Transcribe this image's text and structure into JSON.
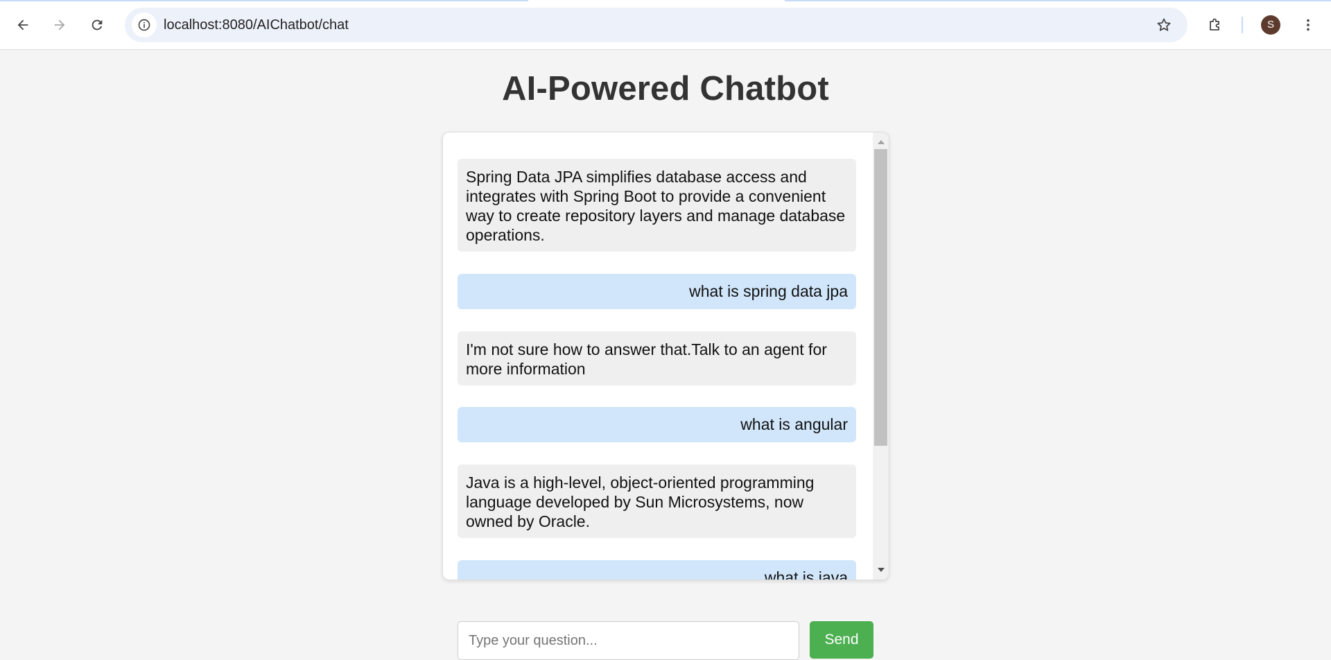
{
  "browser": {
    "url": "localhost:8080/AIChatbot/chat",
    "avatar_initial": "S",
    "icons": {
      "back": "arrow-left-icon",
      "forward": "arrow-right-icon",
      "reload": "reload-icon",
      "site_info": "site-info-icon",
      "bookmark": "star-icon",
      "extensions": "puzzle-icon",
      "menu": "kebab-menu-icon"
    }
  },
  "page": {
    "title": "AI-Powered Chatbot"
  },
  "chat": {
    "messages": [
      {
        "sender": "bot",
        "text": "Spring Data JPA simplifies database access and integrates with Spring Boot to provide a convenient way to create repository layers and manage database operations."
      },
      {
        "sender": "user",
        "text": "what is spring data jpa"
      },
      {
        "sender": "bot",
        "text": "I'm not sure how to answer that.Talk to an agent for more information"
      },
      {
        "sender": "user",
        "text": "what is angular"
      },
      {
        "sender": "bot",
        "text": "Java is a high-level, object-oriented programming language developed by Sun Microsystems, now owned by Oracle."
      },
      {
        "sender": "user",
        "text": "what is java"
      }
    ]
  },
  "composer": {
    "placeholder": "Type your question...",
    "value": "",
    "send_label": "Send"
  },
  "colors": {
    "bot_bubble": "#efefef",
    "user_bubble": "#d1e6fb",
    "send_button": "#4caf50",
    "title": "#333333"
  }
}
